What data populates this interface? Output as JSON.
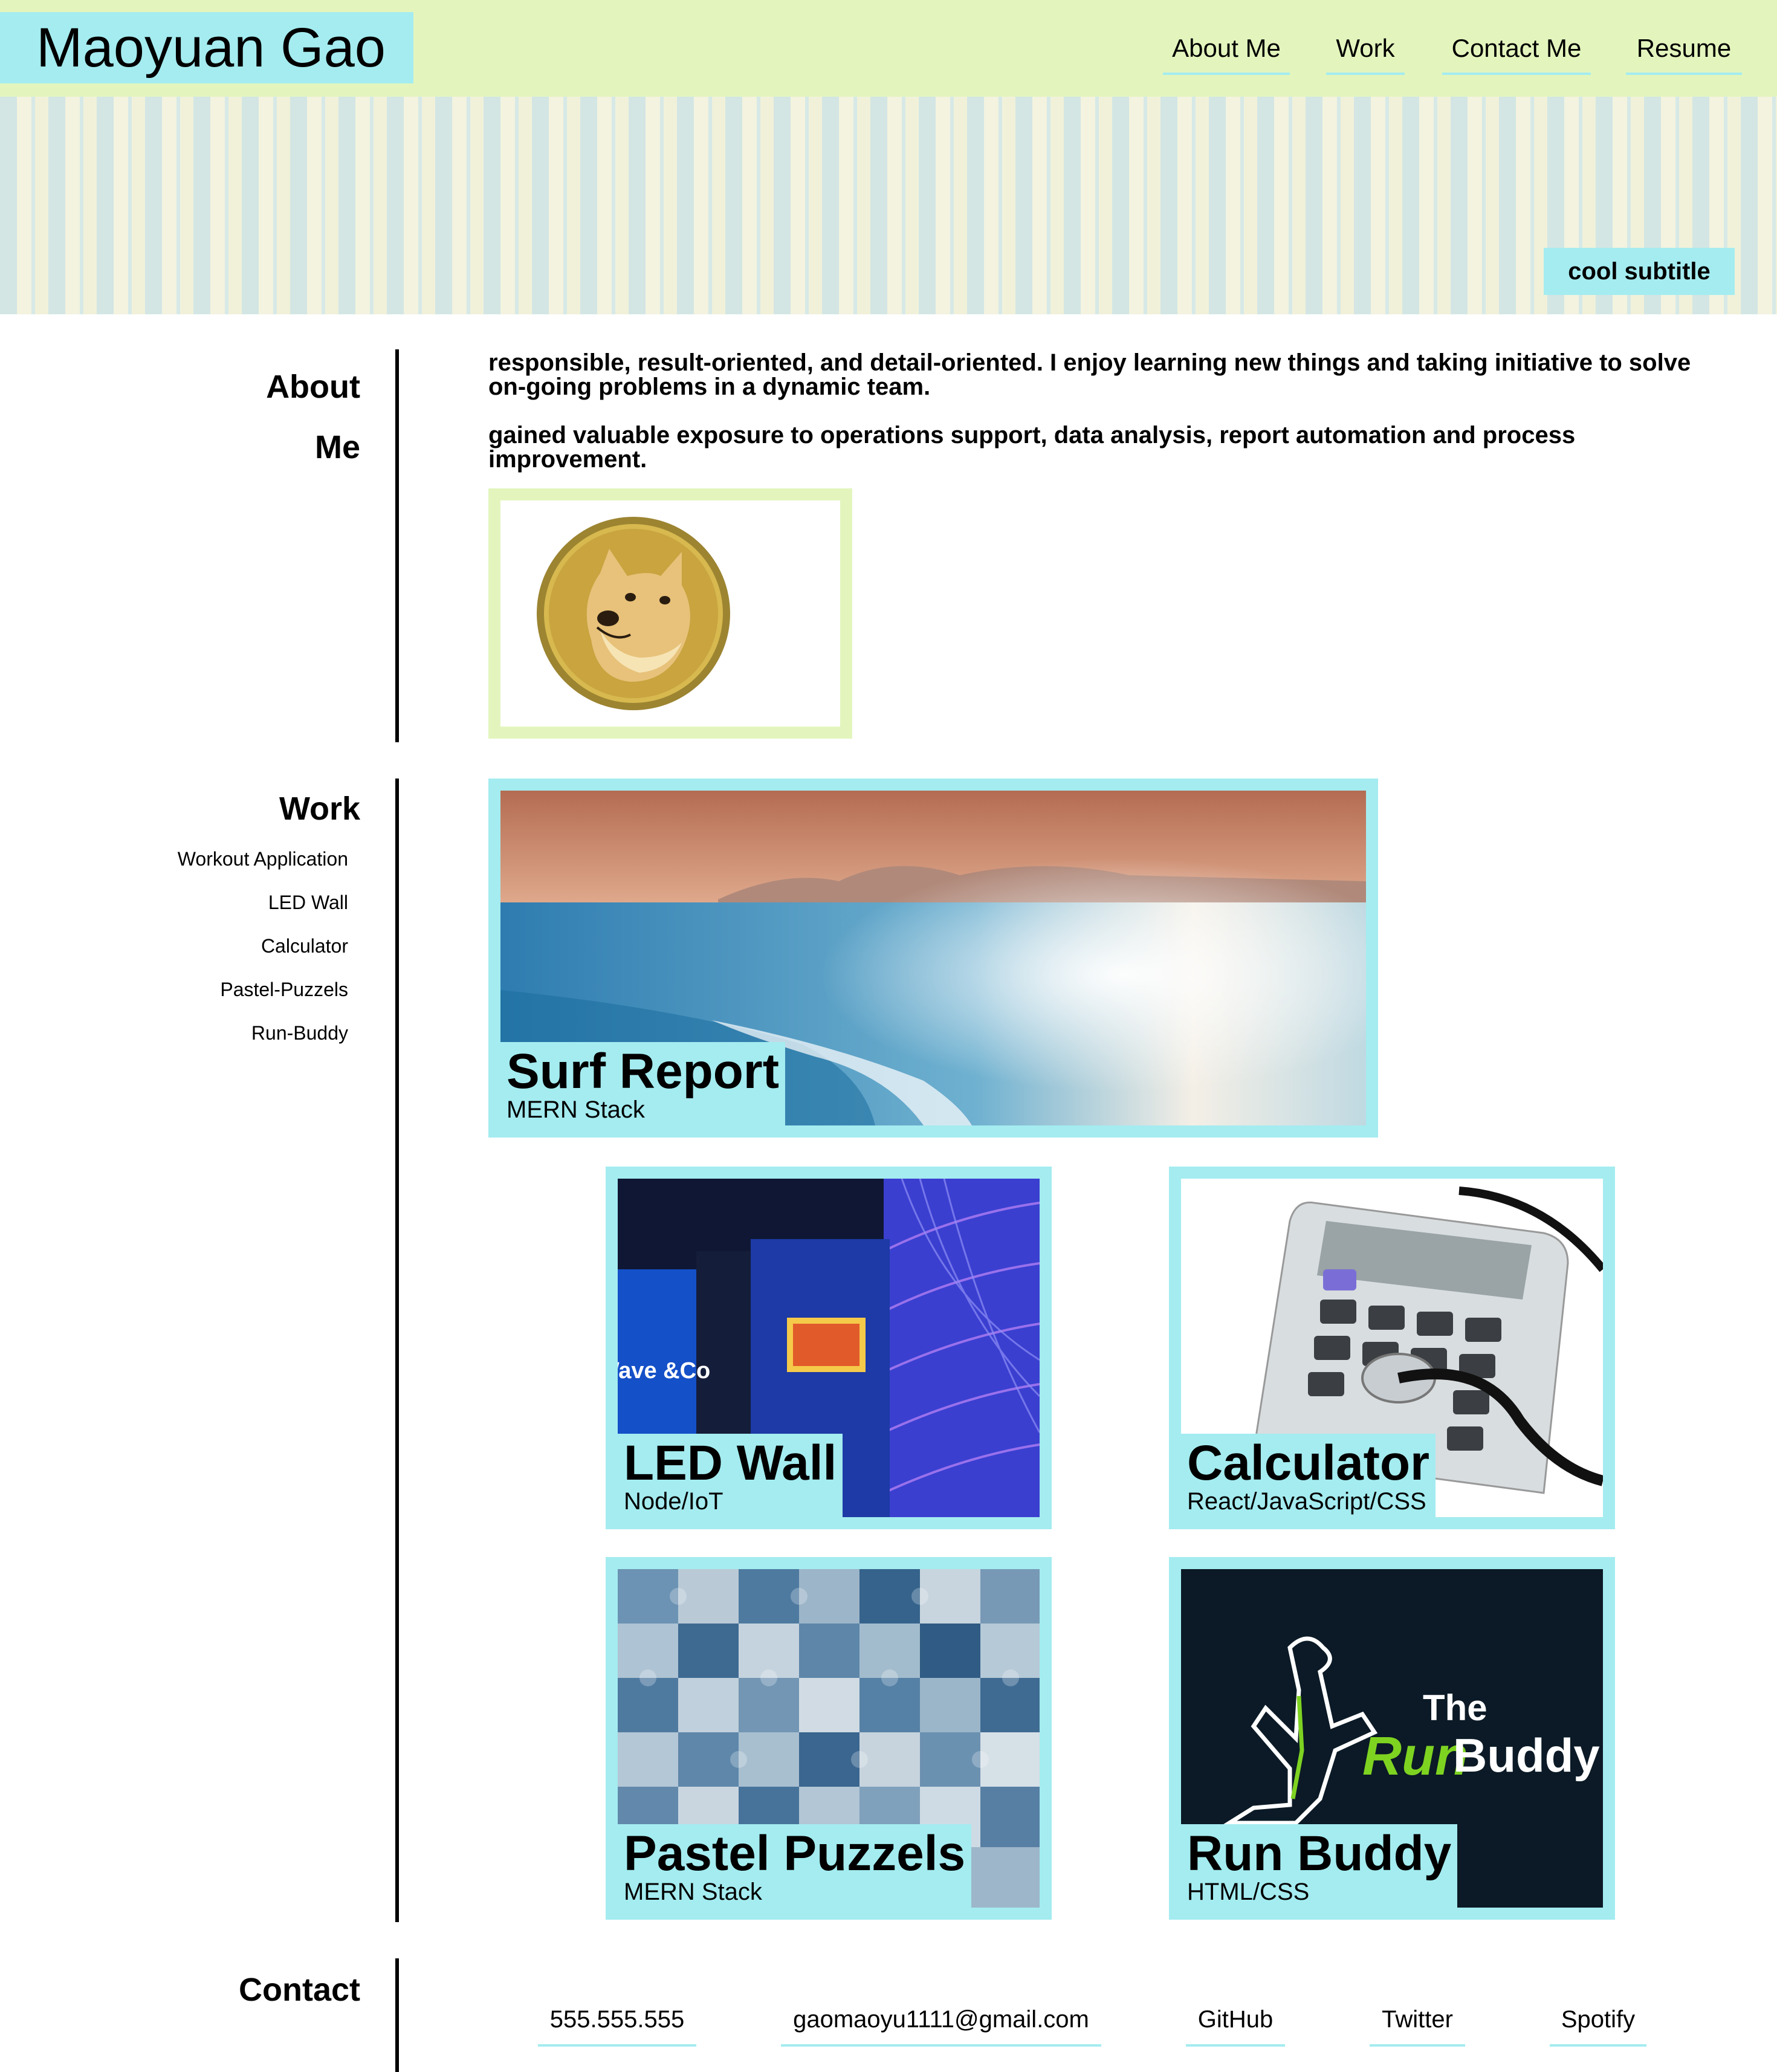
{
  "header": {
    "brand": "Maoyuan Gao",
    "nav": [
      "About Me",
      "Work",
      "Contact Me",
      "Resume"
    ]
  },
  "hero": {
    "subtitle": "cool subtitle"
  },
  "about": {
    "heading_line1": "About",
    "heading_line2": "Me",
    "paragraph1": "responsible, result-oriented, and detail-oriented. I enjoy learning new things and taking initiative to solve on-going problems in a dynamic team.",
    "paragraph2": "gained valuable exposure to operations support, data analysis, report automation and process improvement.",
    "image_icon": "doge-coin-icon"
  },
  "work": {
    "heading": "Work",
    "nav": [
      "Workout Application",
      "LED Wall",
      "Calculator",
      "Pastel-Puzzels",
      "Run-Buddy"
    ],
    "projects": [
      {
        "title": "Surf Report",
        "tech": "MERN Stack"
      },
      {
        "title": "LED Wall",
        "tech": "Node/IoT"
      },
      {
        "title": "Calculator",
        "tech": "React/JavaScript/CSS"
      },
      {
        "title": "Pastel Puzzels",
        "tech": "MERN Stack"
      },
      {
        "title": "Run Buddy",
        "tech": "HTML/CSS"
      }
    ],
    "runbuddy_logo": {
      "line1": "The",
      "run": "Run",
      "buddy": "Buddy"
    },
    "led_logo": "Wave &Co"
  },
  "contact": {
    "heading": "Contact",
    "links": [
      "555.555.555",
      "gaomaoyu1111@gmail.com",
      "GitHub",
      "Twitter",
      "Spotify"
    ]
  },
  "colors": {
    "header_bg": "#e3f5bd",
    "accent": "#a4ecf0"
  }
}
